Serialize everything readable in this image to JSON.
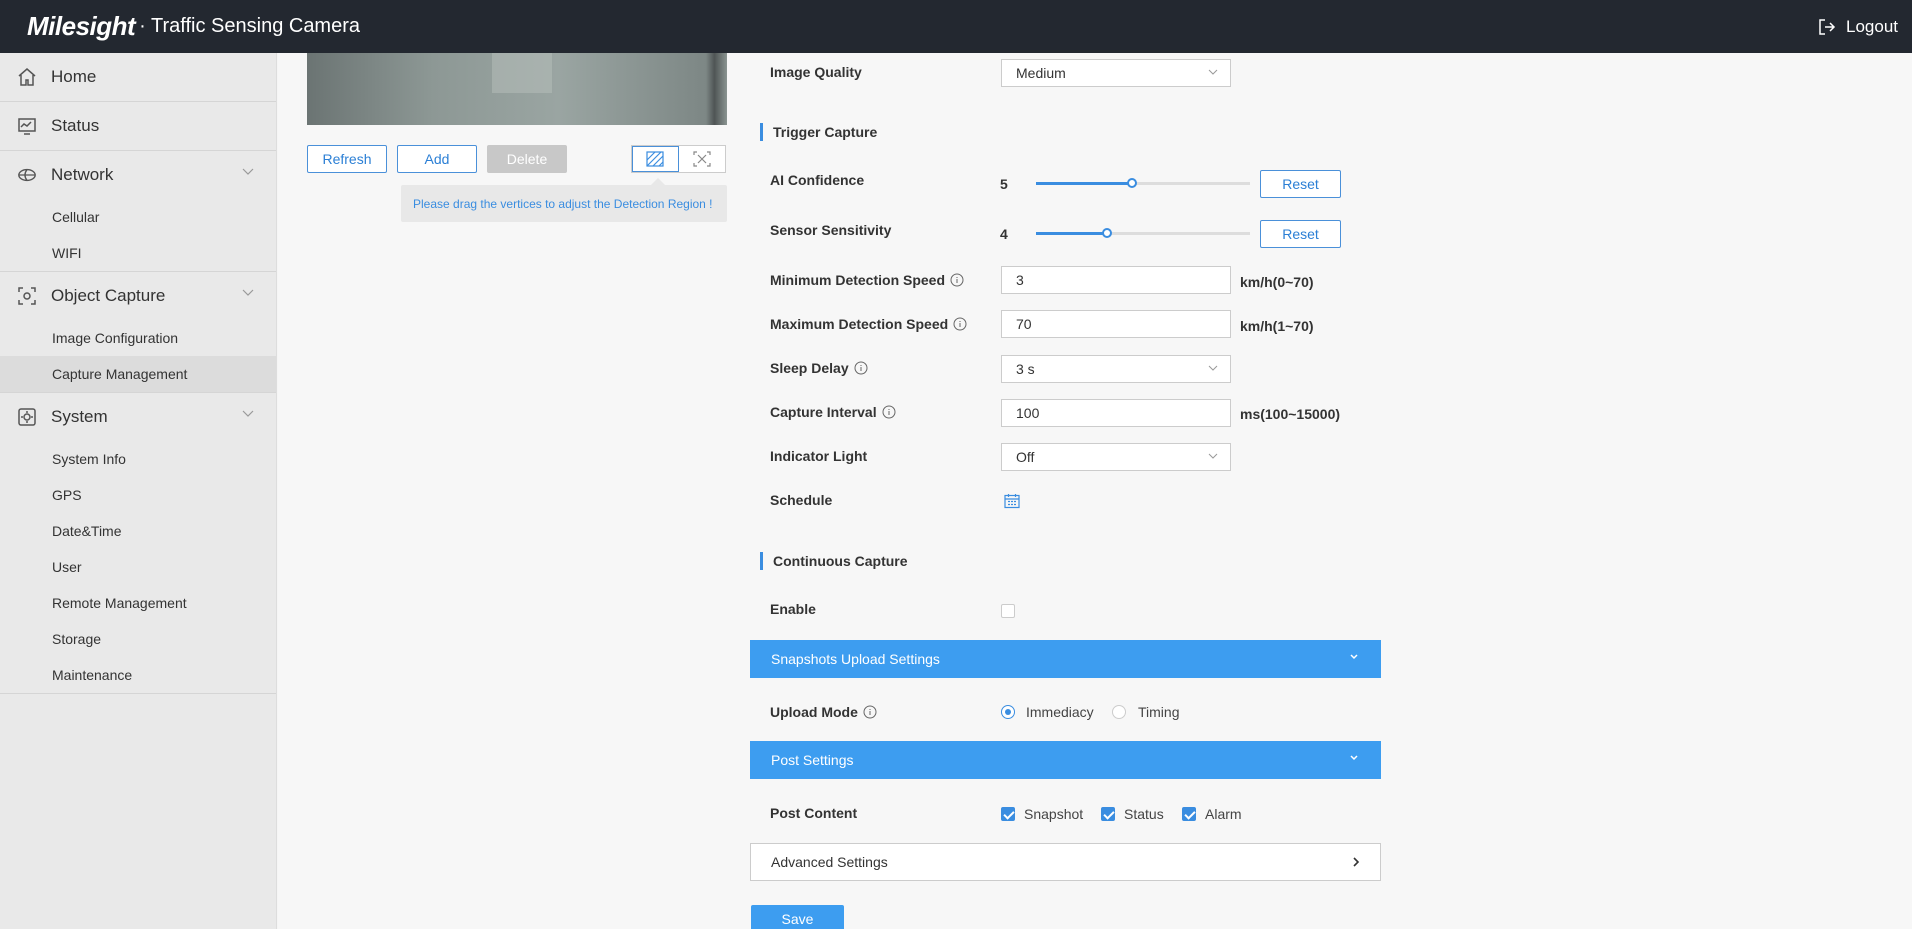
{
  "header": {
    "logo": "Milesight",
    "title": "· Traffic Sensing Camera",
    "logout_label": "Logout"
  },
  "sidebar": {
    "home": "Home",
    "status": "Status",
    "network": {
      "label": "Network",
      "items": [
        "Cellular",
        "WIFI"
      ]
    },
    "object_capture": {
      "label": "Object Capture",
      "items": [
        "Image Configuration",
        "Capture Management"
      ]
    },
    "system": {
      "label": "System",
      "items": [
        "System Info",
        "GPS",
        "Date&Time",
        "User",
        "Remote Management",
        "Storage",
        "Maintenance"
      ]
    }
  },
  "region": {
    "refresh_label": "Refresh",
    "add_label": "Add",
    "delete_label": "Delete",
    "tooltip": "Please drag the vertices to adjust the Detection Region !"
  },
  "form": {
    "image_quality": {
      "label": "Image Quality",
      "value": "Medium"
    },
    "trigger_capture": "Trigger Capture",
    "ai_confidence": {
      "label": "AI Confidence",
      "value": "5",
      "fraction": 0.45
    },
    "sensor_sensitivity": {
      "label": "Sensor Sensitivity",
      "value": "4",
      "fraction": 0.33
    },
    "reset_label": "Reset",
    "min_speed": {
      "label": "Minimum Detection Speed",
      "value": "3",
      "unit": "km/h(0~70)"
    },
    "max_speed": {
      "label": "Maximum Detection Speed",
      "value": "70",
      "unit": "km/h(1~70)"
    },
    "sleep_delay": {
      "label": "Sleep Delay",
      "value": "3 s"
    },
    "capture_interval": {
      "label": "Capture Interval",
      "value": "100",
      "unit": "ms(100~15000)"
    },
    "indicator_light": {
      "label": "Indicator Light",
      "value": "Off"
    },
    "schedule": {
      "label": "Schedule"
    },
    "continuous_capture": "Continuous Capture",
    "enable": {
      "label": "Enable",
      "checked": false
    },
    "snapshots_upload": "Snapshots Upload Settings",
    "upload_mode": {
      "label": "Upload Mode",
      "options": [
        "Immediacy",
        "Timing"
      ],
      "selected": "Immediacy"
    },
    "post_settings": "Post Settings",
    "post_content": {
      "label": "Post Content",
      "options": [
        "Snapshot",
        "Status",
        "Alarm"
      ]
    },
    "advanced_settings": "Advanced Settings",
    "save_label": "Save"
  },
  "colors": {
    "accent": "#3d9df0",
    "header_bg": "#232830",
    "sidebar_bg": "#e9e9e9"
  }
}
